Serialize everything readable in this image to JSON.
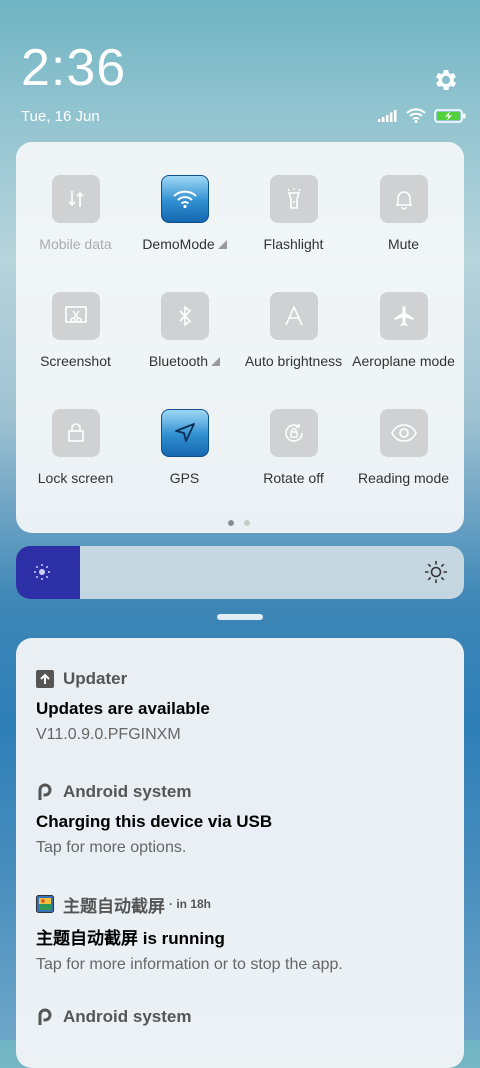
{
  "status": {
    "time": "2:36",
    "date": "Tue, 16 Jun"
  },
  "quick_settings": {
    "tiles": [
      {
        "label": "Mobile data",
        "icon": "mobile-data-icon",
        "active": false,
        "dim": true
      },
      {
        "label": "DemoMode",
        "icon": "wifi-icon",
        "active": true,
        "dropdown": true
      },
      {
        "label": "Flashlight",
        "icon": "flashlight-icon",
        "active": false
      },
      {
        "label": "Mute",
        "icon": "bell-icon",
        "active": false
      },
      {
        "label": "Screenshot",
        "icon": "screenshot-icon",
        "active": false
      },
      {
        "label": "Bluetooth",
        "icon": "bluetooth-icon",
        "active": false,
        "dropdown": true
      },
      {
        "label": "Auto brightness",
        "icon": "auto-brightness-icon",
        "active": false
      },
      {
        "label": "Aeroplane mode",
        "icon": "airplane-icon",
        "active": false
      },
      {
        "label": "Lock screen",
        "icon": "lock-icon",
        "active": false
      },
      {
        "label": "GPS",
        "icon": "gps-icon",
        "active": true
      },
      {
        "label": "Rotate off",
        "icon": "rotate-lock-icon",
        "active": false
      },
      {
        "label": "Reading mode",
        "icon": "eye-icon",
        "active": false
      }
    ],
    "page_count": 2,
    "current_page": 1
  },
  "brightness": {
    "level": 0.1
  },
  "notifications": [
    {
      "app": "Updater",
      "time": "",
      "title": "Updates are available",
      "text": "V11.0.9.0.PFGINXM",
      "icon": "arrow-up-icon"
    },
    {
      "app": "Android system",
      "time": "",
      "title": "Charging this device via USB",
      "text": "Tap for more options.",
      "icon": "android-p-icon"
    },
    {
      "app": "主题自动截屏",
      "time": "· in 18h",
      "title": "主题自动截屏 is running",
      "text": "Tap for more information or to stop the app.",
      "icon": "app-image-icon"
    },
    {
      "app": "Android system",
      "time": "",
      "title": "",
      "text": "",
      "icon": "android-p-icon"
    }
  ]
}
